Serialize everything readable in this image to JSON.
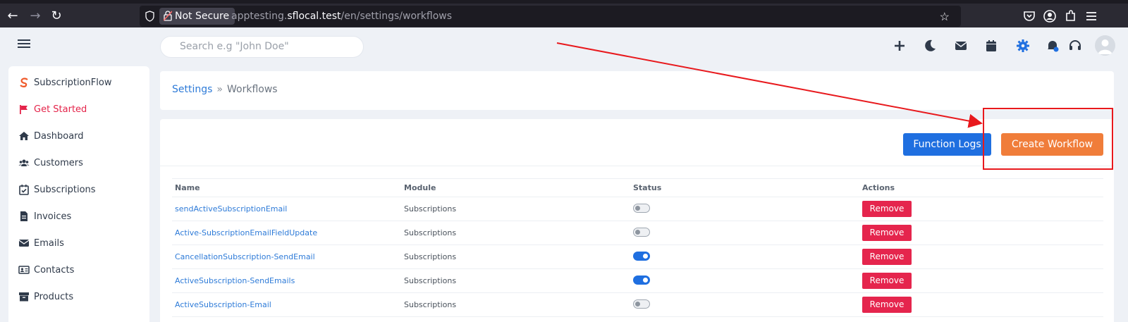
{
  "browser": {
    "not_secure_label": "Not Secure",
    "url_prefix": "apptesting.",
    "url_host": "sflocal.test",
    "url_path": "/en/settings/workflows"
  },
  "header": {
    "search_placeholder": "Search e.g \"John Doe\"",
    "icons": [
      "plus-icon",
      "moon-icon",
      "mail-icon",
      "calendar-icon",
      "gear-icon",
      "bell-icon",
      "headset-icon",
      "avatar"
    ]
  },
  "sidebar": {
    "brand": "SubscriptionFlow",
    "items": [
      {
        "label": "Get Started",
        "icon": "flag-icon",
        "active": true
      },
      {
        "label": "Dashboard",
        "icon": "home-icon"
      },
      {
        "label": "Customers",
        "icon": "users-icon"
      },
      {
        "label": "Subscriptions",
        "icon": "calendar-check-icon"
      },
      {
        "label": "Invoices",
        "icon": "invoice-icon"
      },
      {
        "label": "Emails",
        "icon": "envelope-icon"
      },
      {
        "label": "Contacts",
        "icon": "contact-card-icon"
      },
      {
        "label": "Products",
        "icon": "box-icon"
      }
    ]
  },
  "breadcrumb": {
    "parent": "Settings",
    "separator": "»",
    "current": "Workflows"
  },
  "actions": {
    "function_logs": "Function Logs",
    "create_workflow": "Create Workflow"
  },
  "table": {
    "headers": [
      "Name",
      "Module",
      "Status",
      "Actions"
    ],
    "rows": [
      {
        "name": "sendActiveSubscriptionEmail",
        "module": "Subscriptions",
        "status": false,
        "action": "Remove"
      },
      {
        "name": "Active-SubscriptionEmailFieldUpdate",
        "module": "Subscriptions",
        "status": false,
        "action": "Remove"
      },
      {
        "name": "CancellationSubscription-SendEmail",
        "module": "Subscriptions",
        "status": true,
        "action": "Remove"
      },
      {
        "name": "ActiveSubscription-SendEmails",
        "module": "Subscriptions",
        "status": true,
        "action": "Remove"
      },
      {
        "name": "ActiveSubscription-Email",
        "module": "Subscriptions",
        "status": false,
        "action": "Remove"
      }
    ]
  },
  "colors": {
    "primary": "#1f6fe0",
    "accent": "#f07d3a",
    "danger": "#e5254d",
    "annotation": "#e8191d"
  }
}
